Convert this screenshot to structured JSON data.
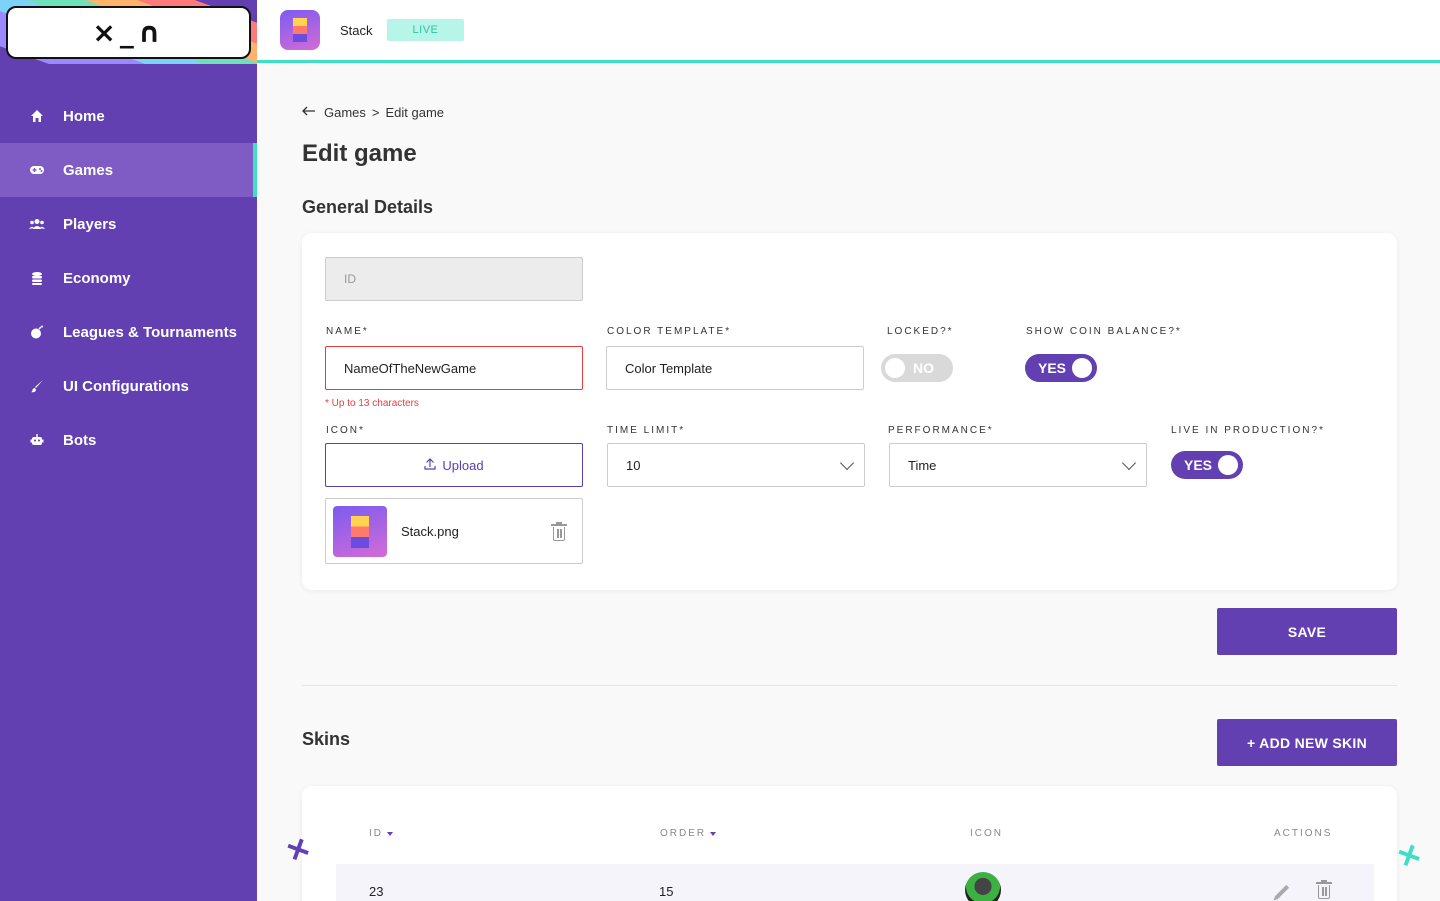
{
  "logo": {
    "face": "×_∩"
  },
  "sidebar": {
    "items": [
      {
        "label": "Home",
        "icon": "home-icon"
      },
      {
        "label": "Games",
        "icon": "gamepad-icon"
      },
      {
        "label": "Players",
        "icon": "users-icon"
      },
      {
        "label": "Economy",
        "icon": "coins-icon"
      },
      {
        "label": "Leagues & Tournaments",
        "icon": "bomb-icon"
      },
      {
        "label": "UI Configurations",
        "icon": "brush-icon"
      },
      {
        "label": "Bots",
        "icon": "robot-icon"
      }
    ],
    "active": "Games"
  },
  "topbar": {
    "game_name": "Stack",
    "status": "LIVE"
  },
  "breadcrumb": {
    "parent": "Games",
    "separator": ">",
    "current": "Edit game"
  },
  "page": {
    "title": "Edit game"
  },
  "general": {
    "title": "General Details",
    "id_placeholder": "ID",
    "name_label": "NAME*",
    "name_value": "NameOfTheNewGame",
    "name_helper": "* Up to 13 characters",
    "color_label": "COLOR TEMPLATE*",
    "color_value": "Color Template",
    "locked_label": "LOCKED?*",
    "locked_value": "NO",
    "coin_label": "SHOW COIN BALANCE?*",
    "coin_value": "YES",
    "icon_label": "ICON*",
    "upload_label": "Upload",
    "file_name": "Stack.png",
    "time_label": "TIME LIMIT*",
    "time_value": "10",
    "performance_label": "PERFORMANCE*",
    "performance_value": "Time",
    "live_label": "LIVE IN PRODUCTION?*",
    "live_value": "YES"
  },
  "actions": {
    "save": "SAVE",
    "add_skin": "+ ADD NEW SKIN"
  },
  "skins": {
    "title": "Skins",
    "headers": {
      "id": "ID",
      "order": "ORDER",
      "icon": "ICON",
      "actions": "ACTIONS"
    },
    "rows": [
      {
        "id": "23",
        "order": "15"
      }
    ]
  },
  "colors": {
    "primary": "#6340b2",
    "accent": "#3ee0c5",
    "error": "#e43e3e"
  }
}
